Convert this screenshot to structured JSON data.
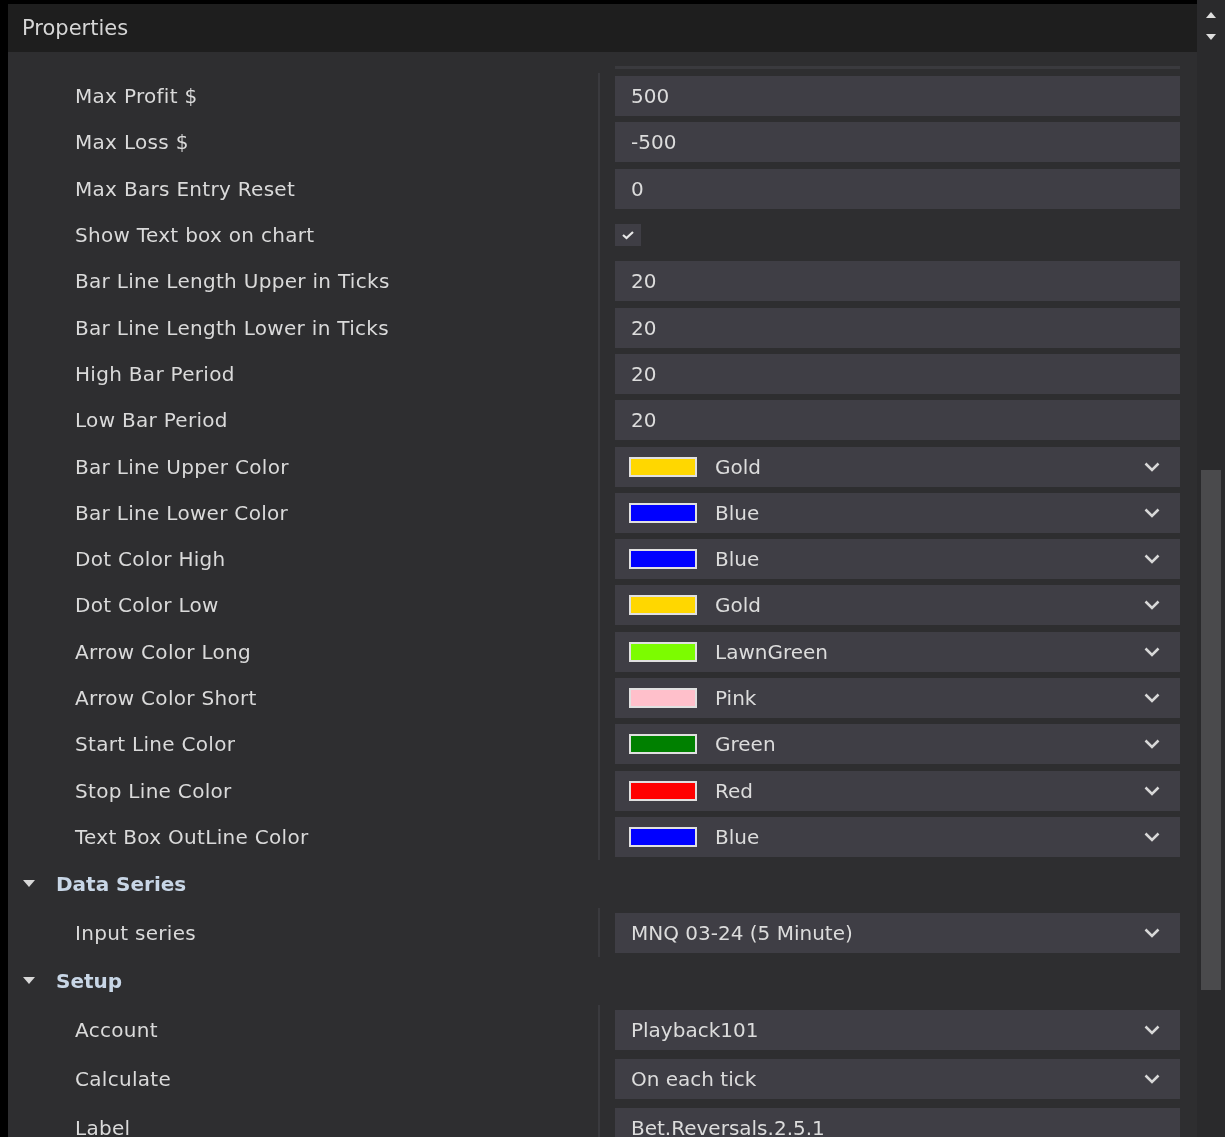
{
  "panel": {
    "title": "Properties"
  },
  "sections": [
    {
      "rows": [
        {
          "label": "Max Profit $",
          "kind": "text",
          "value": "500"
        },
        {
          "label": "Max Loss $",
          "kind": "text",
          "value": "-500"
        },
        {
          "label": "Max Bars Entry Reset",
          "kind": "text",
          "value": "0"
        },
        {
          "label": "Show Text box on chart",
          "kind": "checkbox",
          "checked": true
        },
        {
          "label": "Bar Line Length Upper in Ticks",
          "kind": "text",
          "value": "20"
        },
        {
          "label": "Bar Line Length Lower in Ticks",
          "kind": "text",
          "value": "20"
        },
        {
          "label": "High Bar Period",
          "kind": "text",
          "value": "20"
        },
        {
          "label": "Low Bar Period",
          "kind": "text",
          "value": "20"
        },
        {
          "label": "Bar Line Upper Color",
          "kind": "color",
          "value": "Gold",
          "color": "#ffd700"
        },
        {
          "label": "Bar Line Lower Color",
          "kind": "color",
          "value": "Blue",
          "color": "#0000ff"
        },
        {
          "label": "Dot Color High",
          "kind": "color",
          "value": "Blue",
          "color": "#0000ff"
        },
        {
          "label": "Dot Color Low",
          "kind": "color",
          "value": "Gold",
          "color": "#ffd700"
        },
        {
          "label": "Arrow Color Long",
          "kind": "color",
          "value": "LawnGreen",
          "color": "#7cfc00"
        },
        {
          "label": "Arrow Color Short",
          "kind": "color",
          "value": "Pink",
          "color": "#ffc0cb"
        },
        {
          "label": "Start Line Color",
          "kind": "color",
          "value": "Green",
          "color": "#008000"
        },
        {
          "label": "Stop Line Color",
          "kind": "color",
          "value": "Red",
          "color": "#ff0000"
        },
        {
          "label": "Text Box OutLine Color",
          "kind": "color",
          "value": "Blue",
          "color": "#0000ff"
        }
      ]
    },
    {
      "title": "Data Series",
      "expanded": true,
      "rows": [
        {
          "label": "Input series",
          "kind": "dropdown",
          "value": "MNQ 03-24 (5 Minute)"
        }
      ]
    },
    {
      "title": "Setup",
      "expanded": true,
      "rows": [
        {
          "label": "Account",
          "kind": "dropdown",
          "value": "Playback101"
        },
        {
          "label": "Calculate",
          "kind": "dropdown",
          "value": "On each tick"
        },
        {
          "label": "Label",
          "kind": "text",
          "value": "Bet.Reversals.2.5.1"
        }
      ]
    }
  ]
}
